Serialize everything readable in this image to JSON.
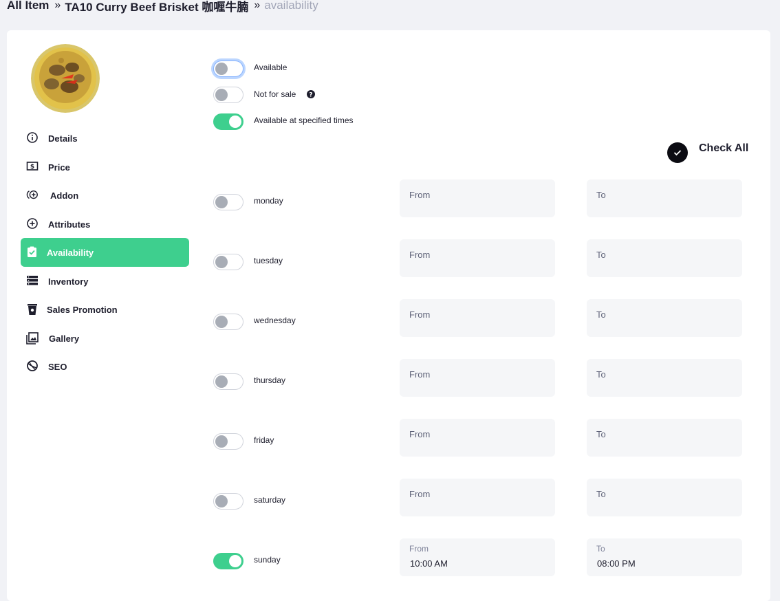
{
  "breadcrumb": {
    "items": [
      "All Item",
      "TA10 Curry Beef Brisket 咖喱牛腩"
    ],
    "current": "availability",
    "separator": "»"
  },
  "sidebar": {
    "items": [
      {
        "label": "Details",
        "icon": "info-circle-icon",
        "active": false
      },
      {
        "label": "Price",
        "icon": "dollar-bill-icon",
        "active": false
      },
      {
        "label": "Addon",
        "icon": "addon-plus-icon",
        "active": false
      },
      {
        "label": "Attributes",
        "icon": "plus-circle-icon",
        "active": false
      },
      {
        "label": "Availability",
        "icon": "clipboard-check-icon",
        "active": true
      },
      {
        "label": "Inventory",
        "icon": "stack-icon",
        "active": false
      },
      {
        "label": "Sales Promotion",
        "icon": "cup-icon",
        "active": false
      },
      {
        "label": "Gallery",
        "icon": "gallery-icon",
        "active": false
      },
      {
        "label": "SEO",
        "icon": "globe-icon",
        "active": false
      }
    ]
  },
  "options": {
    "available": {
      "label": "Available",
      "on": false
    },
    "not_for_sale": {
      "label": "Not for sale",
      "on": false,
      "help_icon": "question-circle-icon"
    },
    "specified_times": {
      "label": "Available at specified times",
      "on": true
    }
  },
  "check_all": {
    "label": "Check All",
    "icon": "check-icon"
  },
  "days": [
    {
      "name": "monday",
      "on": false,
      "from_label": "From",
      "to_label": "To",
      "from": "",
      "to": ""
    },
    {
      "name": "tuesday",
      "on": false,
      "from_label": "From",
      "to_label": "To",
      "from": "",
      "to": ""
    },
    {
      "name": "wednesday",
      "on": false,
      "from_label": "From",
      "to_label": "To",
      "from": "",
      "to": ""
    },
    {
      "name": "thursday",
      "on": false,
      "from_label": "From",
      "to_label": "To",
      "from": "",
      "to": ""
    },
    {
      "name": "friday",
      "on": false,
      "from_label": "From",
      "to_label": "To",
      "from": "",
      "to": ""
    },
    {
      "name": "saturday",
      "on": false,
      "from_label": "From",
      "to_label": "To",
      "from": "",
      "to": ""
    },
    {
      "name": "sunday",
      "on": true,
      "from_label": "From",
      "to_label": "To",
      "from": "10:00 AM",
      "to": "08:00 PM"
    }
  ],
  "colors": {
    "accent": "#3ecf8e",
    "toggle_off_knob": "#a8adb6",
    "field_bg": "#f5f6f8"
  }
}
